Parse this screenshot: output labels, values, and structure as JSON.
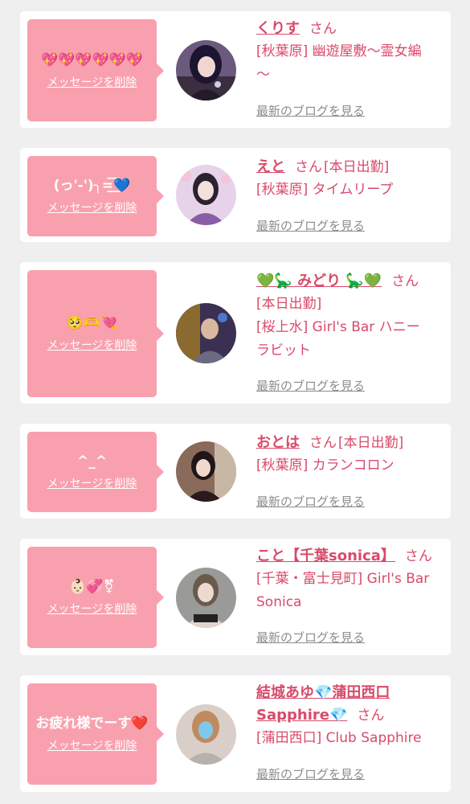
{
  "common": {
    "delete_label": "メッセージを削除",
    "san_label": "さん",
    "blog_link_label": "最新のブログを見る"
  },
  "colors": {
    "page_bg": "#efefef",
    "card_bg": "#ffffff",
    "bubble_bg": "#f9a0ae",
    "accent_text": "#d94a6a",
    "link_gray": "#8c8c8c"
  },
  "messages": [
    {
      "name": "くりす",
      "message": "💖💖💖💖💖💖",
      "status": "",
      "shop_lines": [
        "[秋葉原] 幽遊屋敷〜霊女編",
        "〜"
      ]
    },
    {
      "name": "えと",
      "message": "(っ'-')╮=͟͟͞͞💙",
      "status": "[本日出勤]",
      "shop_lines": [
        "[秋葉原] タイムリープ"
      ]
    },
    {
      "name": "💚🦕 みどり 🦕💚",
      "message": "🥺🫶💘",
      "status": "",
      "shop_lines": [
        "[本日出勤]",
        "[桜上水] Girl's Bar ハニー",
        "ラビット"
      ]
    },
    {
      "name": "おとは",
      "message": "^_^",
      "status": "[本日出勤]",
      "shop_lines": [
        "[秋葉原] カランコロン"
      ]
    },
    {
      "name": "こと【千葉sonica】",
      "message": "👶🏻💞⚧",
      "status": "",
      "shop_lines": [
        "[千葉・富士見町] Girl's Bar",
        "Sonica"
      ]
    },
    {
      "name_line1": "結城あゆ💎蒲田西口",
      "name_line2": "Sapphire💎",
      "message": "お疲れ様でーす❤️",
      "status": "",
      "shop_lines": [
        "[蒲田西口] Club Sapphire"
      ]
    }
  ]
}
